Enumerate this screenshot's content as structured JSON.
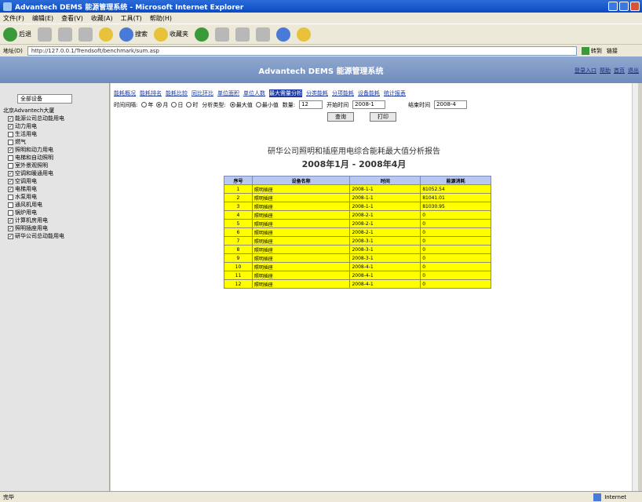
{
  "window": {
    "title": "Advantech DEMS 能源管理系统 - Microsoft Internet Explorer"
  },
  "menu": [
    "文件(F)",
    "编辑(E)",
    "查看(V)",
    "收藏(A)",
    "工具(T)",
    "帮助(H)"
  ],
  "toolbar": {
    "back": "后退",
    "search": "搜索",
    "favorites": "收藏夹"
  },
  "address": {
    "label": "地址(D)",
    "url": "http://127.0.0.1/Trendsoft/benchmark/sum.asp",
    "go": "转到",
    "links": "链接"
  },
  "app": {
    "title": "Advantech DEMS 能源管理系统",
    "links": [
      "登录入口",
      "帮助",
      "首页",
      "退出"
    ]
  },
  "sidebar": {
    "select": "全部设备",
    "root": "北京Advantech大厦",
    "items": [
      {
        "label": "能源公司总动能用电",
        "checked": true
      },
      {
        "label": "动力用电",
        "checked": true
      },
      {
        "label": "生活用电",
        "checked": false
      },
      {
        "label": "燃气",
        "checked": false
      },
      {
        "label": "照明和动力用电",
        "checked": true
      },
      {
        "label": "电梯和自动照明",
        "checked": false
      },
      {
        "label": "室外景观照明",
        "checked": false
      },
      {
        "label": "空调和暖通用电",
        "checked": true
      },
      {
        "label": "空调用电",
        "checked": true
      },
      {
        "label": "电梯用电",
        "checked": true
      },
      {
        "label": "水泵用电",
        "checked": false
      },
      {
        "label": "通风机用电",
        "checked": false
      },
      {
        "label": "锅炉用电",
        "checked": false
      },
      {
        "label": "计算机房用电",
        "checked": true
      },
      {
        "label": "照明插座用电",
        "checked": true
      },
      {
        "label": "研华公司总动能用电",
        "checked": true
      }
    ]
  },
  "nav": [
    "能耗概况",
    "能耗排名",
    "能耗比较",
    "同比环比",
    "单位面积",
    "单位人数",
    "最大需量分析",
    "分类能耗",
    "分项能耗",
    "设备能耗",
    "统计报表"
  ],
  "nav_active": 6,
  "filters": {
    "time_label": "时间间隔:",
    "radios": [
      "年",
      "月",
      "日",
      "时"
    ],
    "radio_selected": 1,
    "type_label": "分析类型:",
    "type_radios": [
      "最大值",
      "最小值"
    ],
    "type_selected": 0,
    "count_label": "数量:",
    "count_value": "12",
    "start_label": "开始时间",
    "start_value": "2008-1",
    "end_label": "结束时间",
    "end_value": "2008-4"
  },
  "buttons": {
    "query": "查询",
    "print": "打印"
  },
  "report": {
    "title": "研华公司照明和插座用电综合能耗最大值分析报告",
    "subtitle": "2008年1月 - 2008年4月"
  },
  "table": {
    "headers": [
      "序号",
      "设备名称",
      "时间",
      "能源消耗"
    ],
    "rows": [
      [
        "1",
        "照明插座",
        "2008-1-1",
        "81052.54"
      ],
      [
        "2",
        "照明插座",
        "2008-1-1",
        "81041.01"
      ],
      [
        "3",
        "照明插座",
        "2008-1-1",
        "81030.95"
      ],
      [
        "4",
        "照明插座",
        "2008-2-1",
        "0"
      ],
      [
        "5",
        "照明插座",
        "2008-2-1",
        "0"
      ],
      [
        "6",
        "照明插座",
        "2008-2-1",
        "0"
      ],
      [
        "7",
        "照明插座",
        "2008-3-1",
        "0"
      ],
      [
        "8",
        "照明插座",
        "2008-3-1",
        "0"
      ],
      [
        "9",
        "照明插座",
        "2008-3-1",
        "0"
      ],
      [
        "10",
        "照明插座",
        "2008-4-1",
        "0"
      ],
      [
        "11",
        "照明插座",
        "2008-4-1",
        "0"
      ],
      [
        "12",
        "照明插座",
        "2008-4-1",
        "0"
      ]
    ]
  },
  "status": {
    "left": "完毕",
    "zone": "Internet"
  },
  "colors": {
    "row_bg": "#ffff00",
    "header_bg": "#b8c8f0",
    "banner": "#7f99c6"
  }
}
